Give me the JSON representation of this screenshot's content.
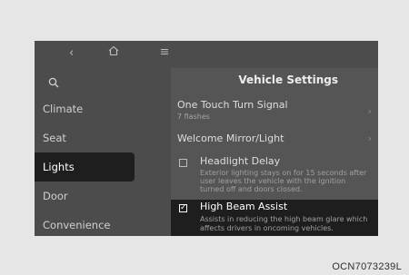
{
  "topbar": {
    "back_icon": "back-icon",
    "home_icon": "home-icon",
    "menu_icon": "menu-icon"
  },
  "sidebar": {
    "search_icon": "search-icon",
    "items": [
      {
        "label": "Climate"
      },
      {
        "label": "Seat"
      },
      {
        "label": "Lights"
      },
      {
        "label": "Door"
      },
      {
        "label": "Convenience"
      }
    ],
    "active": "Lights"
  },
  "main": {
    "title": "Vehicle Settings",
    "rows": [
      {
        "title": "One Touch Turn Signal",
        "subtitle": "7 flashes",
        "has_chevron": true
      },
      {
        "title": "Welcome Mirror/Light",
        "has_chevron": true
      },
      {
        "title": "Headlight Delay",
        "checked": false,
        "description": [
          "Exterior lighting stays on for 15 seconds after",
          "user leaves the vehicle with the ignition",
          "turned off and doors closed."
        ]
      },
      {
        "title": "High Beam Assist",
        "checked": true,
        "description": [
          "Assists in reducing the high beam glare which",
          "affects drivers in oncoming vehicles."
        ]
      }
    ]
  },
  "caption": "OCN7073239L",
  "colors": {
    "active_bg": "#1e1e1e",
    "panel_bg": "#555555",
    "sidebar_bg": "#4c4c4c",
    "text": "#dedede"
  }
}
